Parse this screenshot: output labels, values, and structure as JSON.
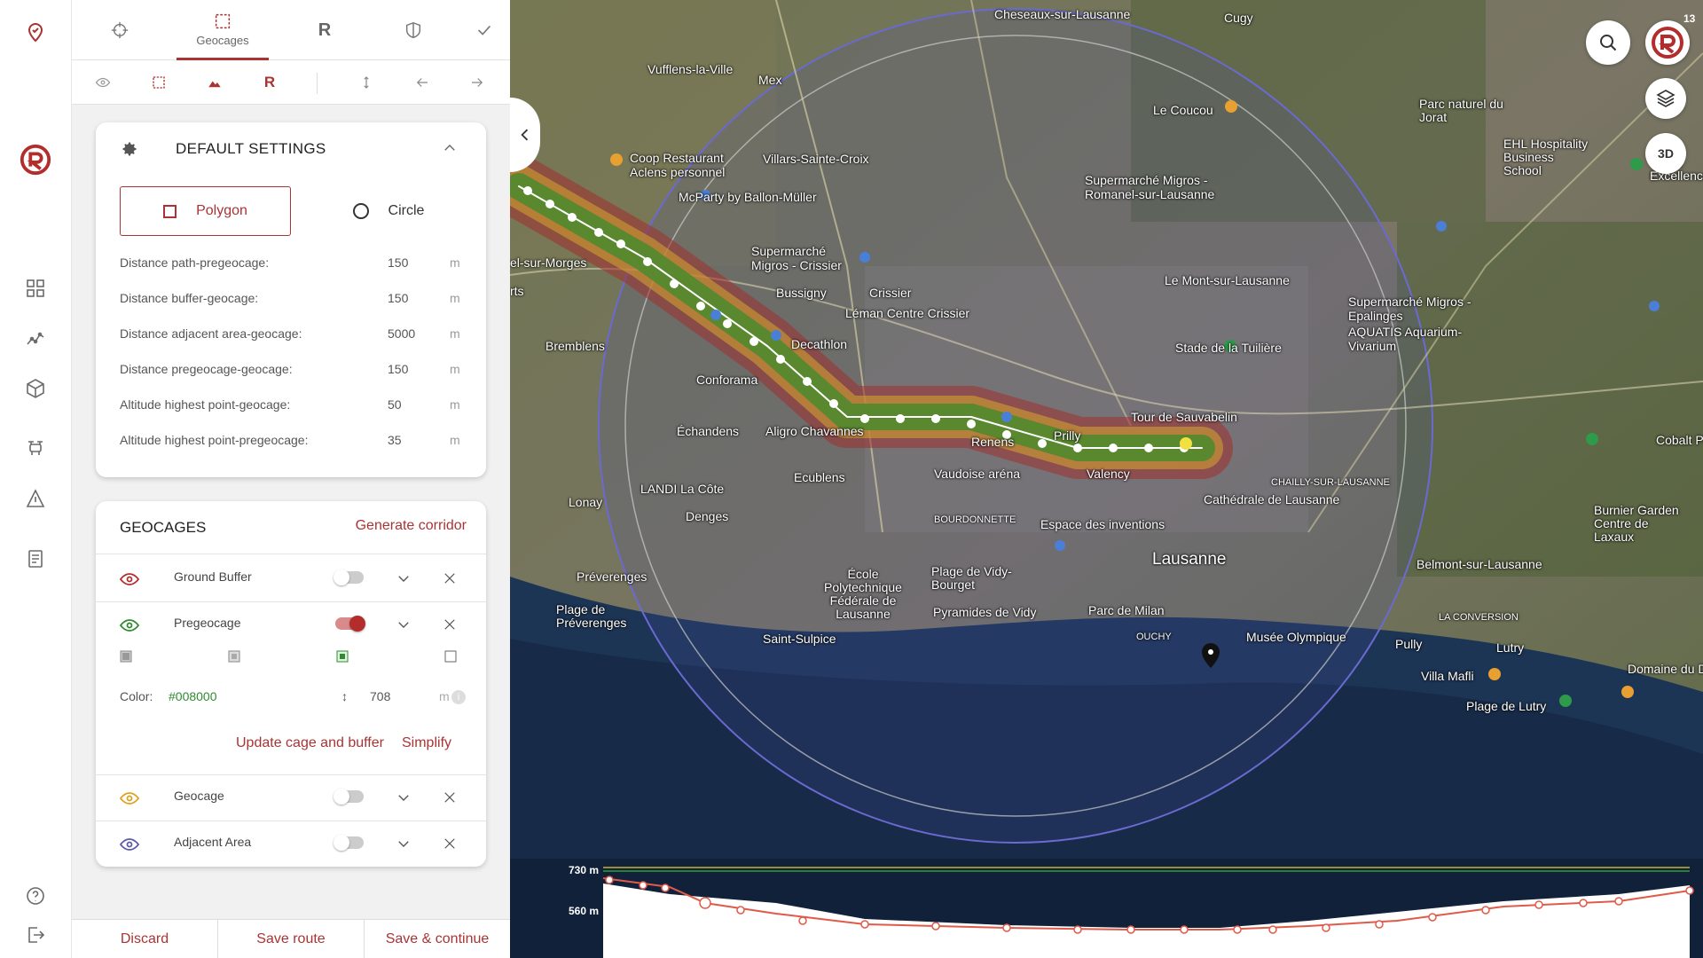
{
  "rail": {
    "icons": [
      "pin-icon",
      "logo-icon",
      "grid-icon",
      "graph-icon",
      "cube-icon",
      "drone-icon",
      "warning-icon",
      "document-icon",
      "help-icon",
      "logout-icon"
    ]
  },
  "tabs": [
    {
      "icon": "crosshair-icon",
      "label": ""
    },
    {
      "icon": "geocage-icon",
      "label": "Geocages"
    },
    {
      "icon": "r-icon",
      "label": "R"
    },
    {
      "icon": "shield-icon",
      "label": ""
    },
    {
      "icon": "check-icon",
      "label": ""
    }
  ],
  "tools": {
    "r_label": "R"
  },
  "settings": {
    "title": "DEFAULT SETTINGS",
    "polygon_label": "Polygon",
    "circle_label": "Circle",
    "rows": [
      {
        "key": "Distance path-pregeocage:",
        "value": "150",
        "unit": "m"
      },
      {
        "key": "Distance buffer-geocage:",
        "value": "150",
        "unit": "m"
      },
      {
        "key": "Distance adjacent area-geocage:",
        "value": "5000",
        "unit": "m"
      },
      {
        "key": "Distance pregeocage-geocage:",
        "value": "150",
        "unit": "m"
      },
      {
        "key": "Altitude highest point-geocage:",
        "value": "50",
        "unit": "m"
      },
      {
        "key": "Altitude highest point-pregeocage:",
        "value": "35",
        "unit": "m"
      }
    ]
  },
  "geocages": {
    "title": "GEOCAGES",
    "generate_label": "Generate corridor",
    "items": [
      {
        "name": "Ground Buffer",
        "eye_color": "#b32d2d",
        "enabled": false
      },
      {
        "name": "Pregeocage",
        "eye_color": "#2e8b2e",
        "enabled": true
      },
      {
        "name": "Geocage",
        "eye_color": "#e0a020",
        "enabled": false
      },
      {
        "name": "Adjacent Area",
        "eye_color": "#5a5aa8",
        "enabled": false
      }
    ],
    "color_label": "Color:",
    "color_value": "#008000",
    "height_value": "708",
    "height_unit": "m",
    "update_label": "Update cage and buffer",
    "simplify_label": "Simplify"
  },
  "footer": {
    "discard": "Discard",
    "save_route": "Save route",
    "save_continue": "Save & continue"
  },
  "map": {
    "badge_count": "13",
    "btn_3d": "3D",
    "labels": [
      "Cheseaux-sur-Lausanne",
      "Cugy",
      "Vufflens-la-Ville",
      "Mex",
      "Le Coucou",
      "Parc naturel du Jorat",
      "Coop Restaurant Aclens personnel",
      "Villars-Sainte-Croix",
      "McParty by Ballon-Müller",
      "Supermarché Migros - Romanel-sur-Lausanne",
      "EHL Hospitality Business School",
      "Supermarché Migros - Crissier",
      "Bussigny",
      "Crissier",
      "Léman Centre Crissier",
      "Le Mont-sur-Lausanne",
      "Supermarché Migros - Epalinges",
      "AQUATIS Aquarium-Vivarium",
      "Bremblens",
      "Decathlon",
      "Stade de la Tuilière",
      "Conforama",
      "Échandens",
      "Aligro Chavannes",
      "Tour de Sauvabelin",
      "Renens",
      "Prilly",
      "Vaudoise aréna",
      "Valency",
      "LANDI La Côte",
      "Ecublens",
      "Lonay",
      "Denges",
      "BOURDONNETTE",
      "Espace des inventions",
      "CHAILLY-SUR-LAUSANNE",
      "Cathédrale de Lausanne",
      "Lausanne",
      "Préverenges",
      "École Polytechnique Fédérale de Lausanne",
      "Plage de Vidy-Bourget",
      "Parc de Milan",
      "Pyramides de Vidy",
      "Plage de Préverenges",
      "Saint-Sulpice",
      "OUCHY",
      "Musée Olympique",
      "Belmont-sur-Lausanne",
      "LA CONVERSION",
      "Pully",
      "Lutry",
      "Villa Mafli",
      "Plage de Lutry",
      "Burnier Garden Centre de Laxaux",
      "Cobalt Pro",
      "World Excellence",
      "Domaine du Dal",
      "el-sur-Morges",
      "rts"
    ]
  },
  "profile": {
    "label_top": "730 m",
    "label_bottom": "560 m"
  },
  "colors": {
    "accent": "#b32d2d",
    "green": "#008000"
  }
}
